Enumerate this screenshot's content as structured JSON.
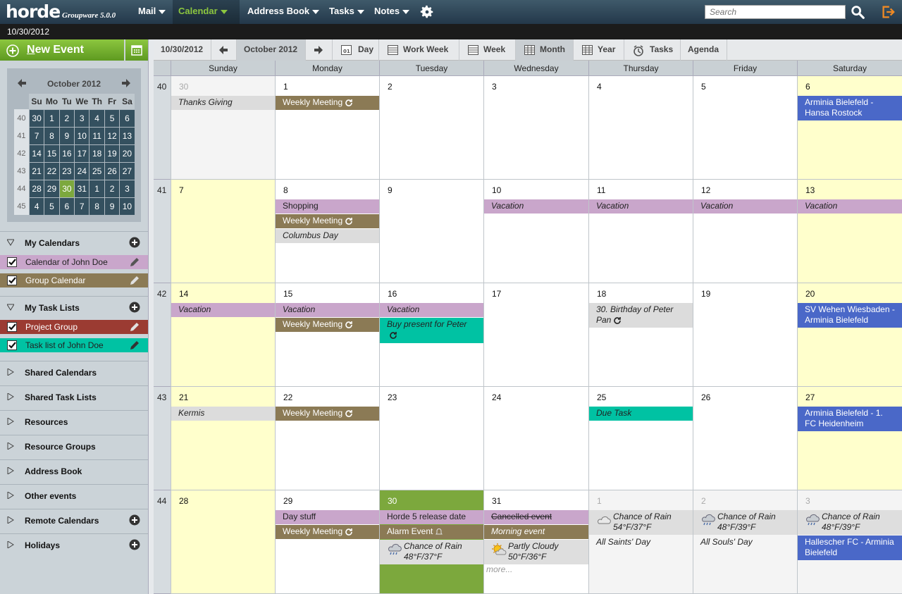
{
  "app": {
    "logo": "horde",
    "logo_sub": "Groupware 5.0.0"
  },
  "menu": [
    {
      "label": "Mail"
    },
    {
      "label": "Calendar"
    },
    {
      "label": "Address Book"
    },
    {
      "label": "Tasks"
    },
    {
      "label": "Notes"
    }
  ],
  "search": {
    "placeholder": "Search"
  },
  "date_bar": "10/30/2012",
  "sidebar": {
    "new_event_first": "N",
    "new_event_rest": "ew Event",
    "minical": {
      "title": "October 2012",
      "weekday_headers": [
        "Su",
        "Mo",
        "Tu",
        "We",
        "Th",
        "Fr",
        "Sa"
      ],
      "weeks": [
        {
          "wk": "40",
          "days": [
            "30",
            "1",
            "2",
            "3",
            "4",
            "5",
            "6"
          ]
        },
        {
          "wk": "41",
          "days": [
            "7",
            "8",
            "9",
            "10",
            "11",
            "12",
            "13"
          ]
        },
        {
          "wk": "42",
          "days": [
            "14",
            "15",
            "16",
            "17",
            "18",
            "19",
            "20"
          ]
        },
        {
          "wk": "43",
          "days": [
            "21",
            "22",
            "23",
            "24",
            "25",
            "26",
            "27"
          ]
        },
        {
          "wk": "44",
          "days": [
            "28",
            "29",
            "30",
            "31",
            "1",
            "2",
            "3"
          ]
        },
        {
          "wk": "45",
          "days": [
            "4",
            "5",
            "6",
            "7",
            "8",
            "9",
            "10"
          ]
        }
      ],
      "today": "30"
    },
    "my_calendars": {
      "title": "My Calendars",
      "items": [
        {
          "label": "Calendar of John Doe",
          "color": "#c9a6cb"
        },
        {
          "label": "Group Calendar",
          "color": "#8b7a55"
        }
      ]
    },
    "my_task_lists": {
      "title": "My Task Lists",
      "items": [
        {
          "label": "Project Group",
          "color": "#9b3b32"
        },
        {
          "label": "Task list of John Doe",
          "color": "#00c2a3"
        }
      ]
    },
    "sections": [
      {
        "label": "Shared Calendars",
        "plus": false
      },
      {
        "label": "Shared Task Lists",
        "plus": false
      },
      {
        "label": "Resources",
        "plus": false
      },
      {
        "label": "Resource Groups",
        "plus": false
      },
      {
        "label": "Address Book",
        "plus": false
      },
      {
        "label": "Other events",
        "plus": false
      },
      {
        "label": "Remote Calendars",
        "plus": true
      },
      {
        "label": "Holidays",
        "plus": true
      }
    ]
  },
  "toolbar": {
    "date": "10/30/2012",
    "month_label": "October 2012",
    "views": [
      "Day",
      "Work Week",
      "Week",
      "Month",
      "Year",
      "Tasks",
      "Agenda"
    ],
    "selected_view": "Month"
  },
  "calendar": {
    "day_headers": [
      "Sunday",
      "Monday",
      "Tuesday",
      "Wednesday",
      "Thursday",
      "Friday",
      "Saturday"
    ],
    "weeks": [
      {
        "wk": "40",
        "days": [
          {
            "n": "30",
            "other": true,
            "events": [
              {
                "t": "Thanks Giving",
                "c": "gray"
              }
            ]
          },
          {
            "n": "1",
            "events": [
              {
                "t": "Weekly Meeting",
                "c": "olive",
                "recur": true
              }
            ]
          },
          {
            "n": "2",
            "events": []
          },
          {
            "n": "3",
            "events": []
          },
          {
            "n": "4",
            "events": []
          },
          {
            "n": "5",
            "events": []
          },
          {
            "n": "6",
            "events": [
              {
                "t": "Arminia Bielefeld - Hansa Rostock",
                "c": "blue",
                "lines": 2
              }
            ]
          }
        ]
      },
      {
        "wk": "41",
        "days": [
          {
            "n": "7",
            "events": []
          },
          {
            "n": "8",
            "events": [
              {
                "t": "Shopping",
                "c": "purple"
              },
              {
                "t": "Weekly Meeting",
                "c": "olive",
                "recur": true
              },
              {
                "t": "Columbus Day",
                "c": "gray"
              }
            ]
          },
          {
            "n": "9",
            "events": []
          },
          {
            "n": "10",
            "events": [
              {
                "t": "Vacation",
                "c": "purplei"
              }
            ]
          },
          {
            "n": "11",
            "events": [
              {
                "t": "Vacation",
                "c": "purplei"
              }
            ]
          },
          {
            "n": "12",
            "events": [
              {
                "t": "Vacation",
                "c": "purplei"
              }
            ]
          },
          {
            "n": "13",
            "events": [
              {
                "t": "Vacation",
                "c": "purplei"
              }
            ]
          }
        ]
      },
      {
        "wk": "42",
        "days": [
          {
            "n": "14",
            "events": [
              {
                "t": "Vacation",
                "c": "purplei"
              }
            ]
          },
          {
            "n": "15",
            "events": [
              {
                "t": "Vacation",
                "c": "purplei"
              },
              {
                "t": "Weekly Meeting",
                "c": "olive",
                "recur": true
              }
            ]
          },
          {
            "n": "16",
            "events": [
              {
                "t": "Vacation",
                "c": "purplei"
              },
              {
                "t": "Buy present for Peter",
                "c": "teal",
                "recur": true,
                "lines": 2
              }
            ]
          },
          {
            "n": "17",
            "events": []
          },
          {
            "n": "18",
            "events": [
              {
                "t": "30. Birthday of Peter Pan",
                "c": "gray",
                "recur": true,
                "lines": 2
              }
            ]
          },
          {
            "n": "19",
            "events": []
          },
          {
            "n": "20",
            "events": [
              {
                "t": "SV Wehen Wiesbaden - Arminia Bielefeld",
                "c": "blue",
                "lines": 2
              }
            ]
          }
        ]
      },
      {
        "wk": "43",
        "days": [
          {
            "n": "21",
            "events": [
              {
                "t": "Kermis",
                "c": "gray"
              }
            ]
          },
          {
            "n": "22",
            "events": [
              {
                "t": "Weekly Meeting",
                "c": "olive",
                "recur": true
              }
            ]
          },
          {
            "n": "23",
            "events": []
          },
          {
            "n": "24",
            "events": []
          },
          {
            "n": "25",
            "events": [
              {
                "t": "Due Task",
                "c": "teal"
              }
            ]
          },
          {
            "n": "26",
            "events": []
          },
          {
            "n": "27",
            "events": [
              {
                "t": "Arminia Bielefeld - 1. FC Heidenheim",
                "c": "blue",
                "lines": 2
              }
            ]
          }
        ]
      },
      {
        "wk": "44",
        "days": [
          {
            "n": "28",
            "events": []
          },
          {
            "n": "29",
            "events": [
              {
                "t": "Day stuff",
                "c": "purple"
              },
              {
                "t": "Weekly Meeting",
                "c": "olive",
                "recur": true
              }
            ]
          },
          {
            "n": "30",
            "today": true,
            "events": [
              {
                "t": "Horde 5 release date",
                "c": "purple"
              },
              {
                "t": "Alarm Event",
                "c": "olive",
                "alarm": true
              },
              {
                "t": "Chance of Rain 48°F/37°F",
                "c": "weather",
                "icon": "rain",
                "lines": 2
              }
            ]
          },
          {
            "n": "31",
            "events": [
              {
                "t": "Cancelled event",
                "c": "purple",
                "strike": true
              },
              {
                "t": "Morning event",
                "c": "olive",
                "italic": true
              },
              {
                "t": "Partly Cloudy 50°F/36°F",
                "c": "weather",
                "icon": "sun",
                "lines": 2
              }
            ],
            "more": "more..."
          },
          {
            "n": "1",
            "other": true,
            "events": [
              {
                "t": "Chance of Rain 54°F/37°F",
                "c": "weather",
                "icon": "cloud",
                "lines": 2
              },
              {
                "t": "All Saints' Day",
                "c": "weathertext"
              }
            ]
          },
          {
            "n": "2",
            "other": true,
            "events": [
              {
                "t": "Chance of Rain 48°F/39°F",
                "c": "weather",
                "icon": "rain",
                "lines": 2
              },
              {
                "t": "All Souls' Day",
                "c": "weathertext"
              }
            ]
          },
          {
            "n": "3",
            "other": true,
            "events": [
              {
                "t": "Chance of Rain 48°F/39°F",
                "c": "weather",
                "icon": "rain",
                "lines": 2
              },
              {
                "t": "Hallescher FC - Arminia Bielefeld",
                "c": "blue",
                "lines": 2
              }
            ]
          }
        ]
      }
    ]
  }
}
